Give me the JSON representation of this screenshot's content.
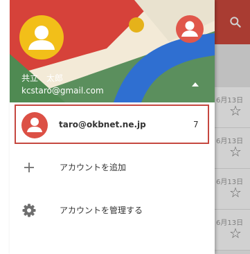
{
  "header": {
    "user_name": "共立　太郎",
    "user_email": "kcstaro@gmail.com",
    "icons": {
      "primary_avatar": "person-avatar-icon",
      "secondary_avatar": "person-avatar-icon",
      "toggle": "caret-up-icon"
    }
  },
  "accounts": [
    {
      "email": "taro@okbnet.ne.jp",
      "count": "7",
      "icon": "person-avatar-icon"
    }
  ],
  "menu": [
    {
      "label": "アカウントを追加",
      "icon": "plus-icon"
    },
    {
      "label": "アカウントを管理する",
      "icon": "gear-icon"
    }
  ],
  "background_app": {
    "dates": [
      "6月13日",
      "6月13日",
      "6月13日",
      "6月13日"
    ],
    "icons": [
      "search-icon",
      "clear-icon",
      "star-icon"
    ]
  },
  "colors": {
    "header_green": "#5b8f5d",
    "header_red": "#d6423a",
    "header_blue": "#2f6fd1",
    "header_cream": "#f3ead7",
    "avatar_yellow": "#f2bf19",
    "avatar_red": "#e0574b",
    "highlight_border": "#c5473f"
  }
}
